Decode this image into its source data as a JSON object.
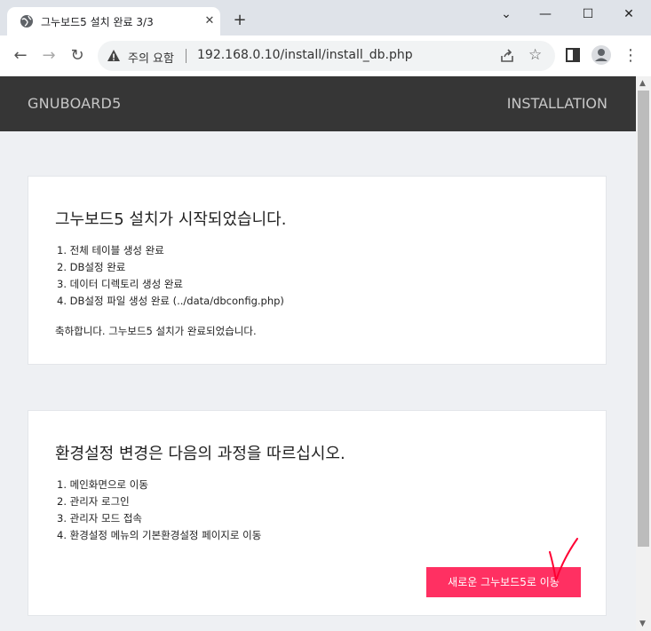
{
  "browser": {
    "tab_title": "그누보드5 설치 완료 3/3",
    "close_glyph": "✕",
    "new_tab_glyph": "+",
    "minimize_glyph": "⌄",
    "maximize_glyph": "—",
    "restore_glyph": "☐",
    "window_close_glyph": "✕",
    "back_glyph": "←",
    "forward_glyph": "→",
    "reload_glyph": "↻",
    "security_warning": "주의 요함",
    "url": "192.168.0.10/install/install_db.php",
    "bookmark_glyph": "☆",
    "menu_glyph": "⋮"
  },
  "site": {
    "logo": "GNUBOARD5",
    "header_right": "INSTALLATION"
  },
  "install_complete": {
    "title": "그누보드5 설치가 시작되었습니다.",
    "steps": [
      "1. 전체 테이블 생성 완료",
      "2. DB설정 완료",
      "3. 데이터 디렉토리 생성 완료",
      "4. DB설정 파일 생성 완료 (../data/dbconfig.php)"
    ],
    "message": "축하합니다. 그누보드5 설치가 완료되었습니다."
  },
  "config_guide": {
    "title": "환경설정 변경은 다음의 과정을 따르십시오.",
    "steps": [
      "1. 메인화면으로 이동",
      "2. 관리자 로그인",
      "3. 관리자 모드 접속",
      "4. 환경설정 메뉴의 기본환경설정 페이지로 이동"
    ],
    "button_label": "새로운 그누보드5로 이동"
  },
  "colors": {
    "header_bg": "#363636",
    "button_bg": "#ff3062",
    "annotation": "#ff0033"
  },
  "icons": [
    "globe-icon",
    "warning-icon",
    "share-icon",
    "star-icon",
    "sidebar-icon",
    "profile-icon",
    "menu-icon",
    "checkmark-annotation-icon"
  ]
}
